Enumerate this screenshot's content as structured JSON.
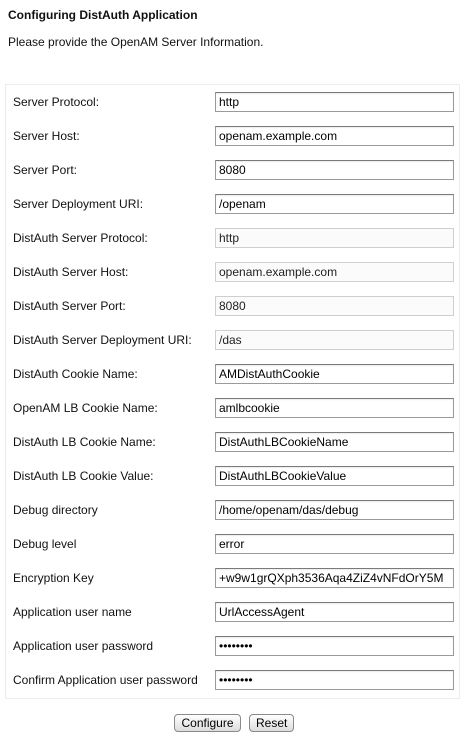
{
  "header": {
    "title": "Configuring DistAuth Application",
    "subtitle": "Please provide the OpenAM Server Information."
  },
  "form": {
    "fields": [
      {
        "label": "Server Protocol:",
        "value": "http",
        "disabled": false
      },
      {
        "label": "Server Host:",
        "value": "openam.example.com",
        "disabled": false
      },
      {
        "label": "Server Port:",
        "value": "8080",
        "disabled": false
      },
      {
        "label": "Server Deployment URI:",
        "value": "/openam",
        "disabled": false
      },
      {
        "label": "DistAuth Server Protocol:",
        "value": "http",
        "disabled": true
      },
      {
        "label": "DistAuth Server Host:",
        "value": "openam.example.com",
        "disabled": true
      },
      {
        "label": "DistAuth Server Port:",
        "value": "8080",
        "disabled": true
      },
      {
        "label": "DistAuth Server Deployment URI:",
        "value": "/das",
        "disabled": true
      },
      {
        "label": "DistAuth Cookie Name:",
        "value": "AMDistAuthCookie",
        "disabled": false
      },
      {
        "label": "OpenAM LB Cookie Name:",
        "value": "amlbcookie",
        "disabled": false
      },
      {
        "label": "DistAuth LB Cookie Name:",
        "value": "DistAuthLBCookieName",
        "disabled": false
      },
      {
        "label": "DistAuth LB Cookie Value:",
        "value": "DistAuthLBCookieValue",
        "disabled": false
      },
      {
        "label": "Debug directory",
        "value": "/home/openam/das/debug",
        "disabled": false
      },
      {
        "label": "Debug level",
        "value": "error",
        "disabled": false
      },
      {
        "label": "Encryption Key",
        "value": "+w9w1grQXph3536Aqa4ZiZ4vNFdOrY5M",
        "disabled": false
      },
      {
        "label": "Application user name",
        "value": "UrlAccessAgent",
        "disabled": false
      },
      {
        "label": "Application user password",
        "value": "••••••••",
        "disabled": false
      },
      {
        "label": "Confirm Application user password",
        "value": "••••••••",
        "disabled": false
      }
    ]
  },
  "buttons": {
    "configure_label": "Configure",
    "reset_label": "Reset"
  }
}
